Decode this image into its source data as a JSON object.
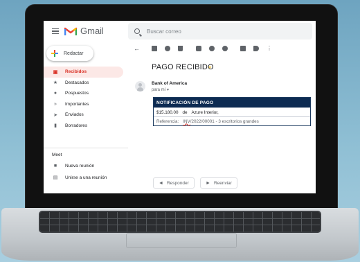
{
  "app": {
    "name": "Gmail",
    "brand_colors": {
      "red": "#ea4335",
      "blue": "#4285f4",
      "yellow": "#fbbc04",
      "green": "#34a853"
    }
  },
  "search": {
    "placeholder": "Buscar correo"
  },
  "sidebar": {
    "compose_label": "Redactar",
    "items": [
      {
        "label": "Recibidos",
        "icon": "inbox-icon",
        "active": true
      },
      {
        "label": "Destacados",
        "icon": "star-icon"
      },
      {
        "label": "Pospuestos",
        "icon": "clock-icon"
      },
      {
        "label": "Importantes",
        "icon": "important-icon"
      },
      {
        "label": "Enviados",
        "icon": "send-icon"
      },
      {
        "label": "Borradores",
        "icon": "draft-icon"
      }
    ],
    "meet": {
      "title": "Meet",
      "items": [
        {
          "label": "Nueva reunión",
          "icon": "video-icon"
        },
        {
          "label": "Unirse a una reunión",
          "icon": "keyboard-icon"
        }
      ]
    }
  },
  "email": {
    "subject": "PAGO RECIBIDO",
    "sender": "Bank of America",
    "to": "para mí",
    "notice": {
      "header": "NOTIFICACIÓN DE PAGO",
      "amount": "$15.180.00",
      "connector": "de",
      "company": "Azure Interior,",
      "ref_label": "Referencia:",
      "ref_flagged": "INV",
      "ref_rest": "/2022/00001 - 3 escritorios grandes"
    },
    "reply_label": "Responder",
    "forward_label": "Reenviar"
  }
}
